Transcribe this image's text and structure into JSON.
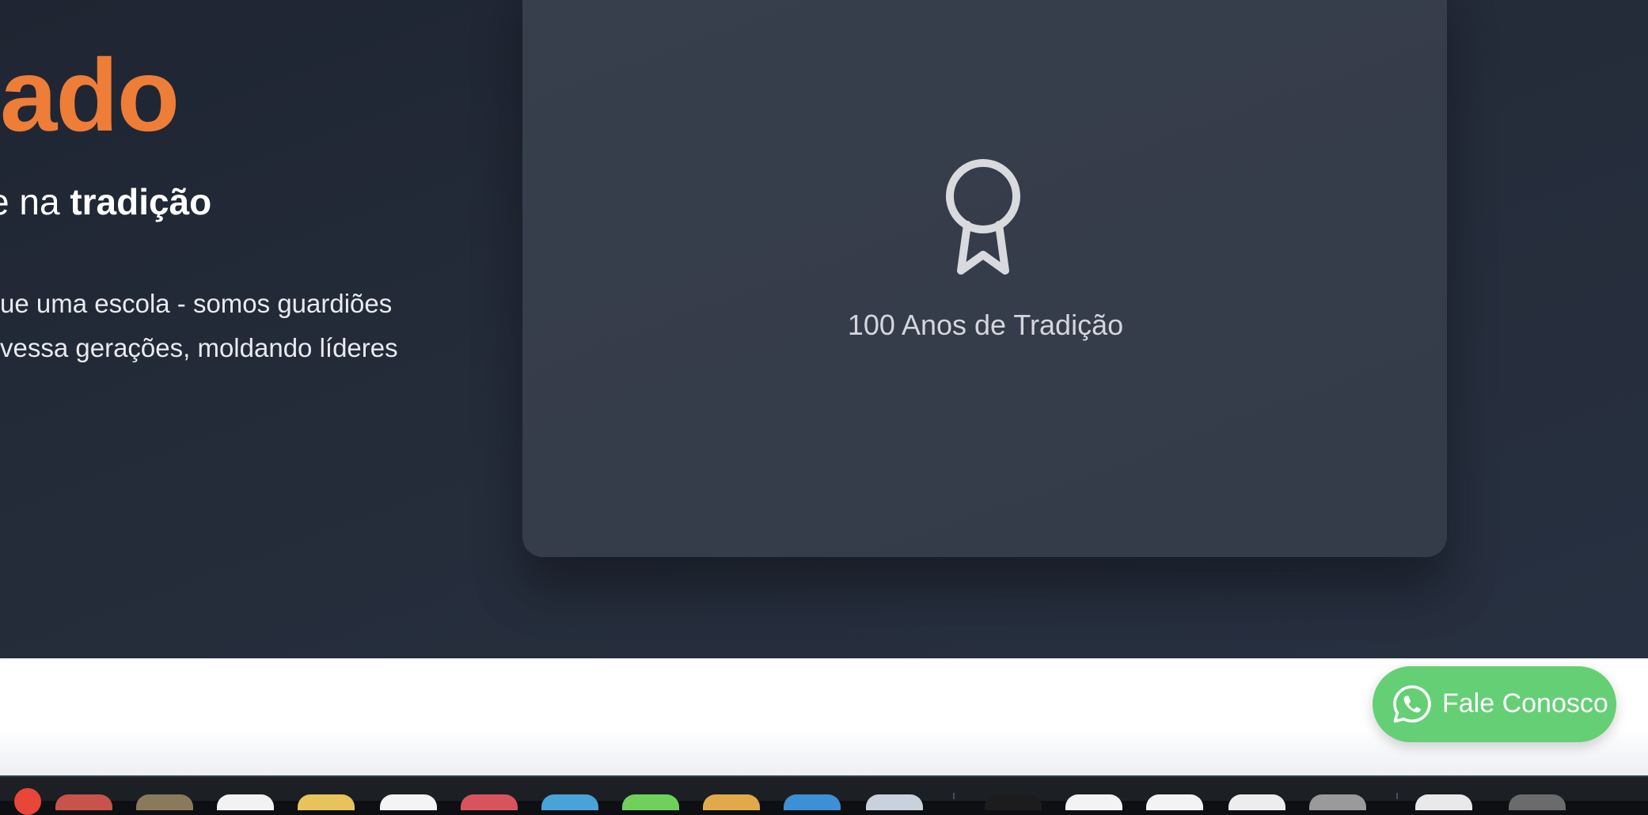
{
  "hero": {
    "heading_fragment": "ado",
    "subtitle_prefix": "e na ",
    "subtitle_bold": "tradição",
    "body_lines": [
      "ue uma escola - somos guardiões",
      "vessa gerações, moldando líderes"
    ]
  },
  "card": {
    "icon": "award-ribbon-icon",
    "label": "100 Anos de Tradição"
  },
  "whatsapp": {
    "icon": "whatsapp-icon",
    "label": "Fale Conosco",
    "color": "#65cf76"
  },
  "colors": {
    "accent": "#ee7d37",
    "hero_bg": "#252d3b",
    "card_bg": "#363d4b"
  },
  "dock": {
    "icons": [
      {
        "color": "#c8534a"
      },
      {
        "color": "#8a7a5c"
      },
      {
        "color": "#f2f2f2"
      },
      {
        "color": "#e6c45a"
      },
      {
        "color": "#f4f4f4"
      },
      {
        "color": "#d9535f"
      },
      {
        "color": "#4aa3d8"
      },
      {
        "color": "#6fd15b"
      },
      {
        "color": "#e2a94b"
      },
      {
        "color": "#3d8fd6"
      },
      {
        "color": "#c9d2dc"
      },
      {
        "color": "#1c1c1c"
      },
      {
        "color": "#f3f3f3"
      },
      {
        "color": "#f3f3f3"
      },
      {
        "color": "#ededed"
      },
      {
        "color": "#9a9a9a"
      },
      {
        "color": "#e9e9e9"
      },
      {
        "color": "#6b6b6b"
      }
    ]
  }
}
